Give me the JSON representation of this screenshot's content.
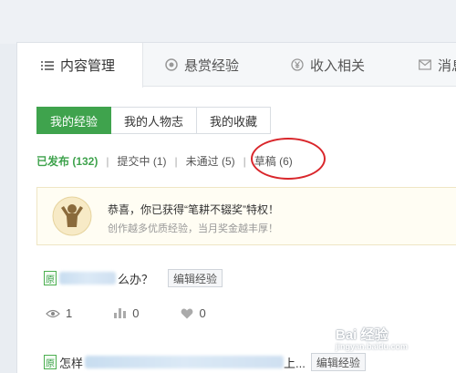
{
  "tabs": [
    {
      "label": "内容管理",
      "icon": "list-icon",
      "active": true
    },
    {
      "label": "悬赏经验",
      "icon": "coin-icon"
    },
    {
      "label": "收入相关",
      "icon": "yen-icon"
    },
    {
      "label": "消息",
      "icon": "mail-icon"
    }
  ],
  "subtabs": [
    {
      "label": "我的经验",
      "active": true
    },
    {
      "label": "我的人物志"
    },
    {
      "label": "我的收藏"
    }
  ],
  "filters": [
    {
      "label": "已发布 (132)",
      "active": true
    },
    {
      "label": "提交中 (1)"
    },
    {
      "label": "未通过 (5)"
    },
    {
      "label": "草稿 (6)"
    }
  ],
  "privilege": {
    "title": "恭喜，你已获得“笔耕不辍奖”特权！",
    "subtitle": "创作越多优质经验，当月奖金越丰厚！"
  },
  "items": [
    {
      "badge": "原",
      "title_visible": "么办？",
      "edit_label": "编辑经验"
    },
    {
      "badge": "原",
      "title_prefix": "怎样",
      "title_suffix": "上...",
      "edit_label": "编辑经验"
    }
  ],
  "stats": {
    "views": "1",
    "votes": "0",
    "likes": "0"
  },
  "watermark": {
    "text": "Bai 经验",
    "sub": "jingyan.baidu.com"
  },
  "colors": {
    "accent": "#3fa34d",
    "highlight_circle": "#d9262b"
  }
}
